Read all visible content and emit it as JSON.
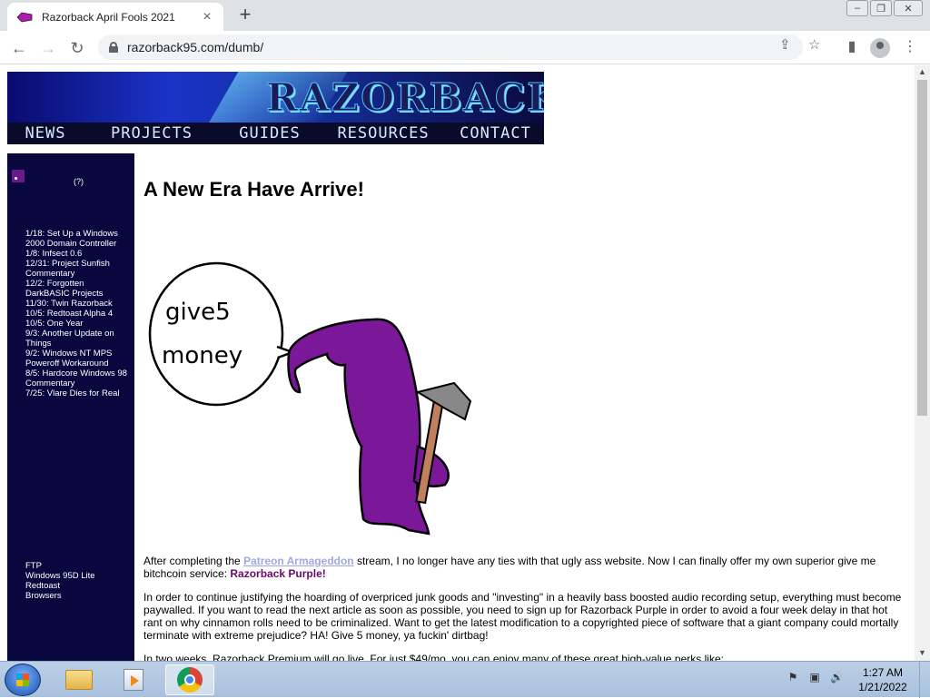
{
  "browser": {
    "tab_title": "Razorback April Fools 2021",
    "url": "razorback95.com/dumb/"
  },
  "site": {
    "logo_text": "RAZORBACK",
    "nav": [
      "NEWS",
      "PROJECTS",
      "GUIDES",
      "RESOURCES",
      "CONTACT"
    ]
  },
  "sidebar": {
    "rss_hint": "(?)",
    "news": [
      "1/18: Set Up a Windows 2000 Domain Controller",
      "1/8: Infsect 0.6",
      "12/31: Project Sunfish Commentary",
      "12/2: Forgotten DarkBASIC Projects",
      "11/30: Twin Razorback",
      "10/5: Redtoast Alpha 4",
      "10/5: One Year",
      "9/3: Another Update on Things",
      "9/2: Windows NT MPS Poweroff Workaround",
      "8/5: Hardcore Windows 98 Commentary",
      "7/25: Vlare Dies for Real"
    ],
    "links": [
      "FTP",
      "Windows 95D Lite",
      "Redtoast",
      "Browsers"
    ]
  },
  "article": {
    "title": "A New Era Have Arrive!",
    "bubble_text_1": "give5",
    "bubble_text_2": "money",
    "p1_a": "After completing the ",
    "p1_link": "Patreon Armageddon",
    "p1_b": " stream, I no longer have any ties with that ugly ass website. Now I can finally offer my own superior give me bitchcoin service: ",
    "p1_brand": "Razorback Purple!",
    "p2": "In order to continue justifying the hoarding of overpriced junk goods and \"investing\" in a heavily bass boosted audio recording setup, everything must become paywalled. If you want to read the next article as soon as possible, you need to sign up for Razorback Purple in order to avoid a four week delay in that hot rant on why cinnamon rolls need to be criminalized. Want to get the latest modification to a copyrighted piece of software that a giant company could mortally terminate with extreme prejudice? HA! Give 5 money, ya fuckin' dirtbag!",
    "p3": "In two weeks, Razorback Premium will go live. For just $49/mo, you can enjoy many of these great high-value perks like:"
  },
  "taskbar": {
    "time": "1:27 AM",
    "date": "1/21/2022"
  }
}
